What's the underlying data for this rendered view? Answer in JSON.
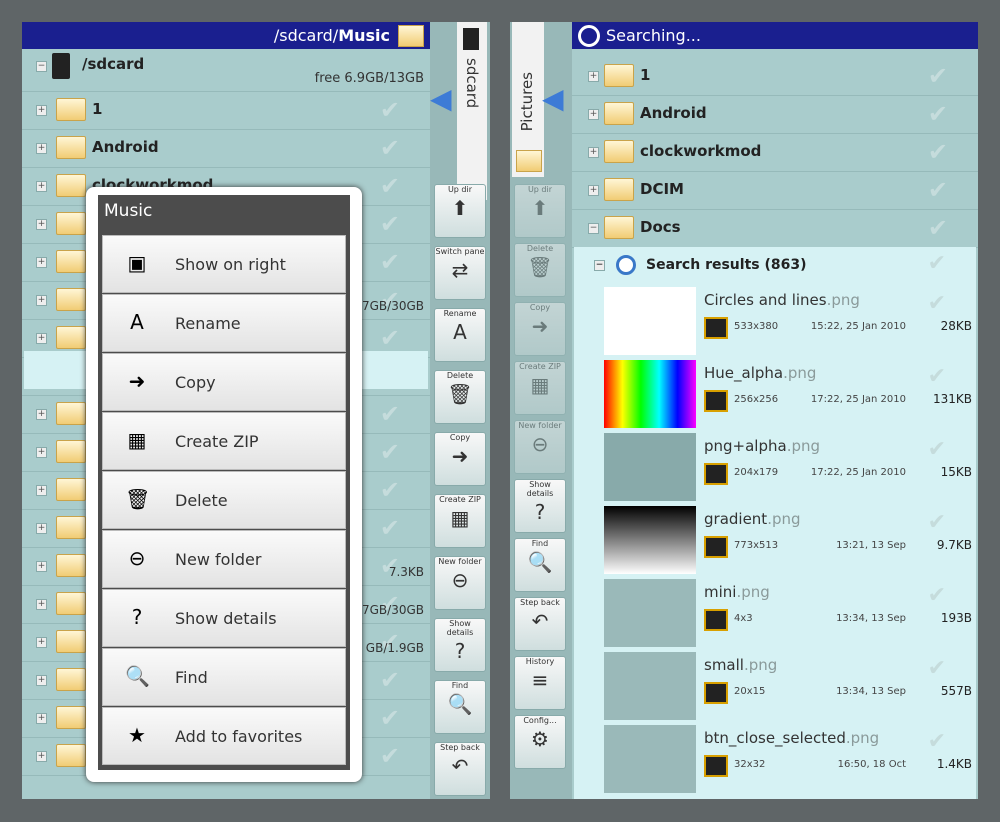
{
  "left": {
    "path_prefix": "/sdcard/",
    "path_bold": "Music",
    "root_label": "/sdcard",
    "root_free": "free 6.9GB/13GB",
    "rows": [
      {
        "label": "1",
        "meta": ""
      },
      {
        "label": "Android",
        "meta": ""
      },
      {
        "label": "clockworkmod",
        "meta": ""
      },
      {
        "label": "",
        "meta": ""
      },
      {
        "label": "",
        "meta": ""
      },
      {
        "label": "",
        "meta": "7GB/30GB"
      },
      {
        "label": "",
        "meta": ""
      },
      {
        "label": "",
        "meta": ""
      },
      {
        "label": "",
        "meta": ""
      },
      {
        "label": "",
        "meta": ""
      },
      {
        "label": "",
        "meta": ""
      },
      {
        "label": "",
        "meta": ""
      },
      {
        "label": "",
        "meta": "7.3KB"
      },
      {
        "label": "",
        "meta": "7GB/30GB"
      },
      {
        "label": "",
        "meta": "GB/1.9GB"
      },
      {
        "label": "",
        "meta": ""
      },
      {
        "label": "",
        "meta": ""
      },
      {
        "label": "",
        "meta": ""
      }
    ],
    "side_tab": "sdcard"
  },
  "toolbar_left": [
    {
      "label": "Up dir",
      "icon": "arrow-up-icon",
      "glyph": "⬆"
    },
    {
      "label": "Switch pane",
      "icon": "switch-pane-icon",
      "glyph": "⇄"
    },
    {
      "label": "Rename",
      "icon": "rename-icon",
      "glyph": "A"
    },
    {
      "label": "Delete",
      "icon": "trash-icon",
      "glyph": "🗑"
    },
    {
      "label": "Copy",
      "icon": "copy-icon",
      "glyph": "➜"
    },
    {
      "label": "Create ZIP",
      "icon": "zip-icon",
      "glyph": "▦"
    },
    {
      "label": "New folder",
      "icon": "new-folder-icon",
      "glyph": "⊖"
    },
    {
      "label": "Show details",
      "icon": "details-icon",
      "glyph": "?"
    },
    {
      "label": "Find",
      "icon": "find-icon",
      "glyph": "🔍"
    },
    {
      "label": "Step back",
      "icon": "step-back-icon",
      "glyph": "↶"
    }
  ],
  "context_menu": {
    "title": "Music",
    "items": [
      {
        "label": "Show on right",
        "icon": "show-on-right-icon",
        "glyph": "▣"
      },
      {
        "label": "Rename",
        "icon": "rename-icon",
        "glyph": "A"
      },
      {
        "label": "Copy",
        "icon": "copy-icon",
        "glyph": "➜"
      },
      {
        "label": "Create ZIP",
        "icon": "zip-icon",
        "glyph": "▦"
      },
      {
        "label": "Delete",
        "icon": "trash-icon",
        "glyph": "🗑"
      },
      {
        "label": "New folder",
        "icon": "new-folder-icon",
        "glyph": "⊖"
      },
      {
        "label": "Show details",
        "icon": "details-icon",
        "glyph": "?"
      },
      {
        "label": "Find",
        "icon": "find-icon",
        "glyph": "🔍"
      },
      {
        "label": "Add to favorites",
        "icon": "star-icon",
        "glyph": "★"
      }
    ]
  },
  "right": {
    "title": "Searching...",
    "side_tab": "Pictures",
    "folders": [
      "1",
      "Android",
      "clockworkmod",
      "DCIM",
      "Docs"
    ],
    "search_label": "Search results (863)",
    "results": [
      {
        "name": "Circles and lines",
        "ext": ".png",
        "dim": "533x380",
        "date": "15:22, 25 Jan 2010",
        "size": "28KB"
      },
      {
        "name": "Hue_alpha",
        "ext": ".png",
        "dim": "256x256",
        "date": "17:22, 25 Jan 2010",
        "size": "131KB"
      },
      {
        "name": "png+alpha",
        "ext": ".png",
        "dim": "204x179",
        "date": "17:22, 25 Jan 2010",
        "size": "15KB"
      },
      {
        "name": "gradient",
        "ext": ".png",
        "dim": "773x513",
        "date": "13:21, 13 Sep",
        "size": "9.7KB"
      },
      {
        "name": "mini",
        "ext": ".png",
        "dim": "4x3",
        "date": "13:34, 13 Sep",
        "size": "193B"
      },
      {
        "name": "small",
        "ext": ".png",
        "dim": "20x15",
        "date": "13:34, 13 Sep",
        "size": "557B"
      },
      {
        "name": "btn_close_selected",
        "ext": ".png",
        "dim": "32x32",
        "date": "16:50, 18 Oct",
        "size": "1.4KB"
      }
    ]
  },
  "toolbar_right": [
    {
      "label": "Up dir",
      "icon": "arrow-up-icon",
      "glyph": "⬆"
    },
    {
      "label": "Delete",
      "icon": "trash-icon",
      "glyph": "🗑"
    },
    {
      "label": "Copy",
      "icon": "copy-icon",
      "glyph": "➜"
    },
    {
      "label": "Create ZIP",
      "icon": "zip-icon",
      "glyph": "▦"
    },
    {
      "label": "New folder",
      "icon": "new-folder-icon",
      "glyph": "⊖"
    },
    {
      "label": "Show details",
      "icon": "details-icon",
      "glyph": "?"
    },
    {
      "label": "Find",
      "icon": "find-icon",
      "glyph": "🔍"
    },
    {
      "label": "Step back",
      "icon": "step-back-icon",
      "glyph": "↶"
    },
    {
      "label": "History",
      "icon": "history-icon",
      "glyph": "≡"
    },
    {
      "label": "Config...",
      "icon": "config-icon",
      "glyph": "⚙"
    }
  ]
}
